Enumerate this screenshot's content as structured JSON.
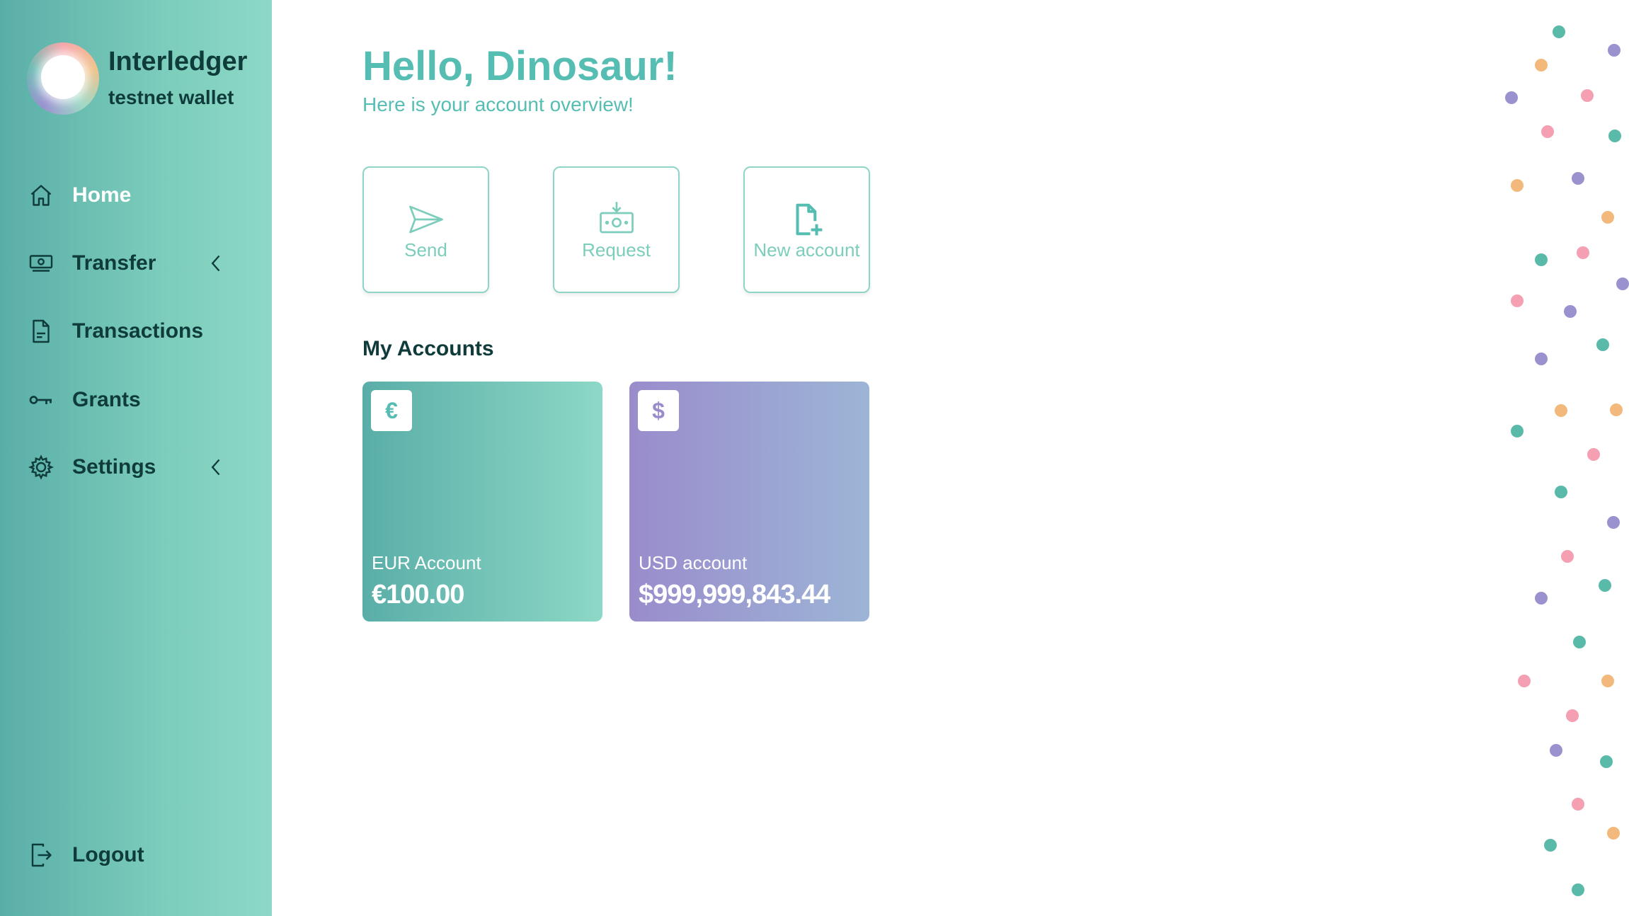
{
  "brand": {
    "title": "Interledger",
    "subtitle": "testnet wallet"
  },
  "nav": {
    "items": [
      {
        "label": "Home",
        "icon": "home-icon",
        "active": true
      },
      {
        "label": "Transfer",
        "icon": "money-icon",
        "expandable": true
      },
      {
        "label": "Transactions",
        "icon": "document-icon"
      },
      {
        "label": "Grants",
        "icon": "key-icon"
      },
      {
        "label": "Settings",
        "icon": "gear-icon",
        "expandable": true
      }
    ],
    "logout": {
      "label": "Logout",
      "icon": "logout-icon"
    }
  },
  "main": {
    "greeting": "Hello, Dinosaur!",
    "subtitle": "Here is your account overview!",
    "actions": [
      {
        "label": "Send",
        "icon": "paper-plane-icon"
      },
      {
        "label": "Request",
        "icon": "request-money-icon"
      },
      {
        "label": "New account",
        "icon": "new-file-icon"
      }
    ],
    "accounts_title": "My Accounts",
    "accounts": [
      {
        "symbol": "€",
        "name": "EUR Account",
        "balance": "€100.00"
      },
      {
        "symbol": "$",
        "name": "USD account",
        "balance": "$999,999,843.44"
      }
    ]
  },
  "colors": {
    "accent": "#56bdb3",
    "dark_text": "#0f3b3a",
    "eur_card": "#5aaea8",
    "usd_card": "#9a8ccc",
    "decor_dots": [
      "#5abaa9",
      "#9a92cf",
      "#f4a0b2",
      "#f2b87c"
    ]
  }
}
